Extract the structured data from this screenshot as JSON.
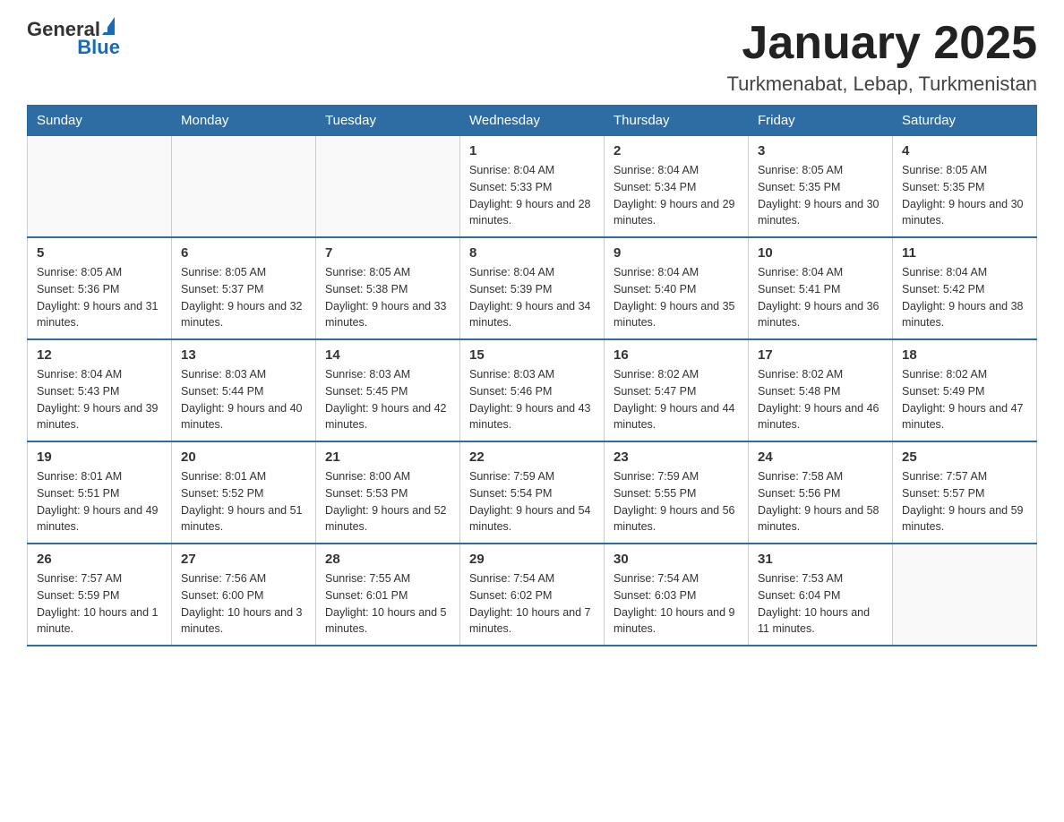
{
  "header": {
    "logo_general": "General",
    "logo_blue": "Blue",
    "month_title": "January 2025",
    "location": "Turkmenabat, Lebap, Turkmenistan"
  },
  "days_of_week": [
    "Sunday",
    "Monday",
    "Tuesday",
    "Wednesday",
    "Thursday",
    "Friday",
    "Saturday"
  ],
  "weeks": [
    [
      {
        "day": "",
        "info": ""
      },
      {
        "day": "",
        "info": ""
      },
      {
        "day": "",
        "info": ""
      },
      {
        "day": "1",
        "info": "Sunrise: 8:04 AM\nSunset: 5:33 PM\nDaylight: 9 hours and 28 minutes."
      },
      {
        "day": "2",
        "info": "Sunrise: 8:04 AM\nSunset: 5:34 PM\nDaylight: 9 hours and 29 minutes."
      },
      {
        "day": "3",
        "info": "Sunrise: 8:05 AM\nSunset: 5:35 PM\nDaylight: 9 hours and 30 minutes."
      },
      {
        "day": "4",
        "info": "Sunrise: 8:05 AM\nSunset: 5:35 PM\nDaylight: 9 hours and 30 minutes."
      }
    ],
    [
      {
        "day": "5",
        "info": "Sunrise: 8:05 AM\nSunset: 5:36 PM\nDaylight: 9 hours and 31 minutes."
      },
      {
        "day": "6",
        "info": "Sunrise: 8:05 AM\nSunset: 5:37 PM\nDaylight: 9 hours and 32 minutes."
      },
      {
        "day": "7",
        "info": "Sunrise: 8:05 AM\nSunset: 5:38 PM\nDaylight: 9 hours and 33 minutes."
      },
      {
        "day": "8",
        "info": "Sunrise: 8:04 AM\nSunset: 5:39 PM\nDaylight: 9 hours and 34 minutes."
      },
      {
        "day": "9",
        "info": "Sunrise: 8:04 AM\nSunset: 5:40 PM\nDaylight: 9 hours and 35 minutes."
      },
      {
        "day": "10",
        "info": "Sunrise: 8:04 AM\nSunset: 5:41 PM\nDaylight: 9 hours and 36 minutes."
      },
      {
        "day": "11",
        "info": "Sunrise: 8:04 AM\nSunset: 5:42 PM\nDaylight: 9 hours and 38 minutes."
      }
    ],
    [
      {
        "day": "12",
        "info": "Sunrise: 8:04 AM\nSunset: 5:43 PM\nDaylight: 9 hours and 39 minutes."
      },
      {
        "day": "13",
        "info": "Sunrise: 8:03 AM\nSunset: 5:44 PM\nDaylight: 9 hours and 40 minutes."
      },
      {
        "day": "14",
        "info": "Sunrise: 8:03 AM\nSunset: 5:45 PM\nDaylight: 9 hours and 42 minutes."
      },
      {
        "day": "15",
        "info": "Sunrise: 8:03 AM\nSunset: 5:46 PM\nDaylight: 9 hours and 43 minutes."
      },
      {
        "day": "16",
        "info": "Sunrise: 8:02 AM\nSunset: 5:47 PM\nDaylight: 9 hours and 44 minutes."
      },
      {
        "day": "17",
        "info": "Sunrise: 8:02 AM\nSunset: 5:48 PM\nDaylight: 9 hours and 46 minutes."
      },
      {
        "day": "18",
        "info": "Sunrise: 8:02 AM\nSunset: 5:49 PM\nDaylight: 9 hours and 47 minutes."
      }
    ],
    [
      {
        "day": "19",
        "info": "Sunrise: 8:01 AM\nSunset: 5:51 PM\nDaylight: 9 hours and 49 minutes."
      },
      {
        "day": "20",
        "info": "Sunrise: 8:01 AM\nSunset: 5:52 PM\nDaylight: 9 hours and 51 minutes."
      },
      {
        "day": "21",
        "info": "Sunrise: 8:00 AM\nSunset: 5:53 PM\nDaylight: 9 hours and 52 minutes."
      },
      {
        "day": "22",
        "info": "Sunrise: 7:59 AM\nSunset: 5:54 PM\nDaylight: 9 hours and 54 minutes."
      },
      {
        "day": "23",
        "info": "Sunrise: 7:59 AM\nSunset: 5:55 PM\nDaylight: 9 hours and 56 minutes."
      },
      {
        "day": "24",
        "info": "Sunrise: 7:58 AM\nSunset: 5:56 PM\nDaylight: 9 hours and 58 minutes."
      },
      {
        "day": "25",
        "info": "Sunrise: 7:57 AM\nSunset: 5:57 PM\nDaylight: 9 hours and 59 minutes."
      }
    ],
    [
      {
        "day": "26",
        "info": "Sunrise: 7:57 AM\nSunset: 5:59 PM\nDaylight: 10 hours and 1 minute."
      },
      {
        "day": "27",
        "info": "Sunrise: 7:56 AM\nSunset: 6:00 PM\nDaylight: 10 hours and 3 minutes."
      },
      {
        "day": "28",
        "info": "Sunrise: 7:55 AM\nSunset: 6:01 PM\nDaylight: 10 hours and 5 minutes."
      },
      {
        "day": "29",
        "info": "Sunrise: 7:54 AM\nSunset: 6:02 PM\nDaylight: 10 hours and 7 minutes."
      },
      {
        "day": "30",
        "info": "Sunrise: 7:54 AM\nSunset: 6:03 PM\nDaylight: 10 hours and 9 minutes."
      },
      {
        "day": "31",
        "info": "Sunrise: 7:53 AM\nSunset: 6:04 PM\nDaylight: 10 hours and 11 minutes."
      },
      {
        "day": "",
        "info": ""
      }
    ]
  ]
}
